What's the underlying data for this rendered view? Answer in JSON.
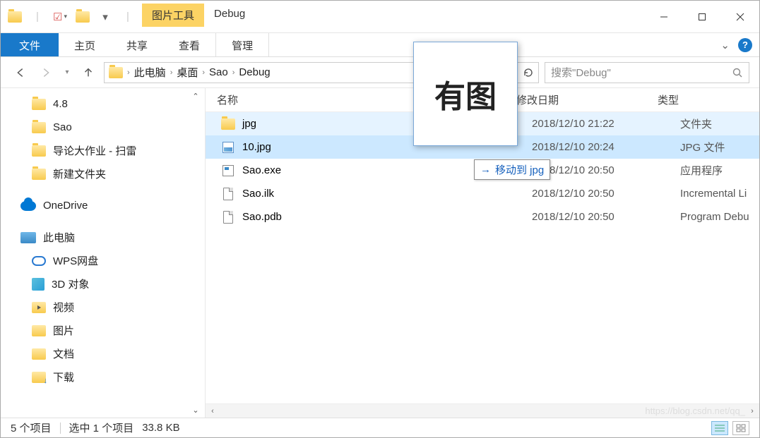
{
  "window": {
    "title": "Debug",
    "contextual_tab": "图片工具"
  },
  "ribbon": {
    "file": "文件",
    "home": "主页",
    "share": "共享",
    "view": "查看",
    "manage": "管理"
  },
  "breadcrumb": [
    "此电脑",
    "桌面",
    "Sao",
    "Debug"
  ],
  "search_placeholder": "搜索\"Debug\"",
  "tree": {
    "quick": [
      {
        "label": "4.8"
      },
      {
        "label": "Sao"
      },
      {
        "label": "导论大作业 - 扫雷"
      },
      {
        "label": "新建文件夹"
      }
    ],
    "onedrive": "OneDrive",
    "thispc": "此电脑",
    "pc_items": [
      {
        "label": "WPS网盘",
        "icon": "wps"
      },
      {
        "label": "3D 对象",
        "icon": "obj3d"
      },
      {
        "label": "视频",
        "icon": "video"
      },
      {
        "label": "图片",
        "icon": "pic"
      },
      {
        "label": "文档",
        "icon": "doc"
      },
      {
        "label": "下载",
        "icon": "dl"
      }
    ]
  },
  "columns": {
    "name": "名称",
    "date": "修改日期",
    "type": "类型"
  },
  "files": [
    {
      "name": "jpg",
      "date": "2018/12/10 21:22",
      "type": "文件夹",
      "icon": "folder",
      "state": "hover"
    },
    {
      "name": "10.jpg",
      "date": "2018/12/10 20:24",
      "type": "JPG 文件",
      "icon": "image",
      "state": "selected"
    },
    {
      "name": "Sao.exe",
      "date": "2018/12/10 20:50",
      "type": "应用程序",
      "icon": "exe",
      "state": ""
    },
    {
      "name": "Sao.ilk",
      "date": "2018/12/10 20:50",
      "type": "Incremental Li",
      "icon": "generic",
      "state": ""
    },
    {
      "name": "Sao.pdb",
      "date": "2018/12/10 20:50",
      "type": "Program Debu",
      "icon": "generic",
      "state": ""
    }
  ],
  "drag": {
    "preview_text": "有图",
    "tip": "移动到 jpg"
  },
  "status": {
    "count": "5 个项目",
    "selection": "选中 1 个项目",
    "size": "33.8 KB"
  },
  "watermark": "https://blog.csdn.net/qq_"
}
